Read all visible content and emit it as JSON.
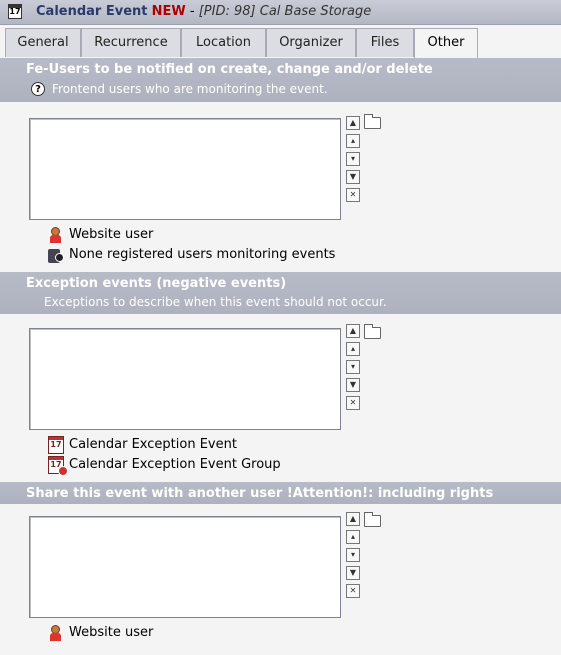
{
  "header": {
    "icon_text": "17",
    "record_type": "Calendar Event",
    "new_label": "NEW",
    "separator": "-",
    "pid": "[PID: 98] Cal Base Storage"
  },
  "tabs": [
    {
      "label": "General"
    },
    {
      "label": "Recurrence"
    },
    {
      "label": "Location"
    },
    {
      "label": "Organizer"
    },
    {
      "label": "Files"
    },
    {
      "label": "Other",
      "active": true
    }
  ],
  "sections": [
    {
      "title": "Fe-Users to be notified on create, change and/or delete",
      "help_icon": "?",
      "description": "Frontend users who are monitoring the event.",
      "items": [
        {
          "label": "Website user",
          "icon": "website-user-icon"
        },
        {
          "label": "None registered users monitoring events",
          "icon": "unregistered-users-icon"
        }
      ]
    },
    {
      "title": "Exception events (negative events)",
      "description": "Exceptions to describe when this event should not occur.",
      "items": [
        {
          "label": "Calendar Exception Event",
          "icon": "calendar-exception-event-icon",
          "icon_text": "17"
        },
        {
          "label": "Calendar Exception Event Group",
          "icon": "calendar-exception-group-icon",
          "icon_text": "17"
        }
      ]
    },
    {
      "title": "Share this event with another user !Attention!: including rights",
      "items": [
        {
          "label": "Website user",
          "icon": "website-user-icon"
        }
      ]
    }
  ],
  "controls": {
    "move_top": "▲",
    "move_up": "▴",
    "move_down": "▾",
    "move_bottom": "▼",
    "remove": "✕"
  },
  "colors": {
    "title_name": "#2b3a6b",
    "new_label": "#b00000",
    "section_header_bg": "#b3b7c4",
    "page_bg": "#f4f4f4"
  }
}
